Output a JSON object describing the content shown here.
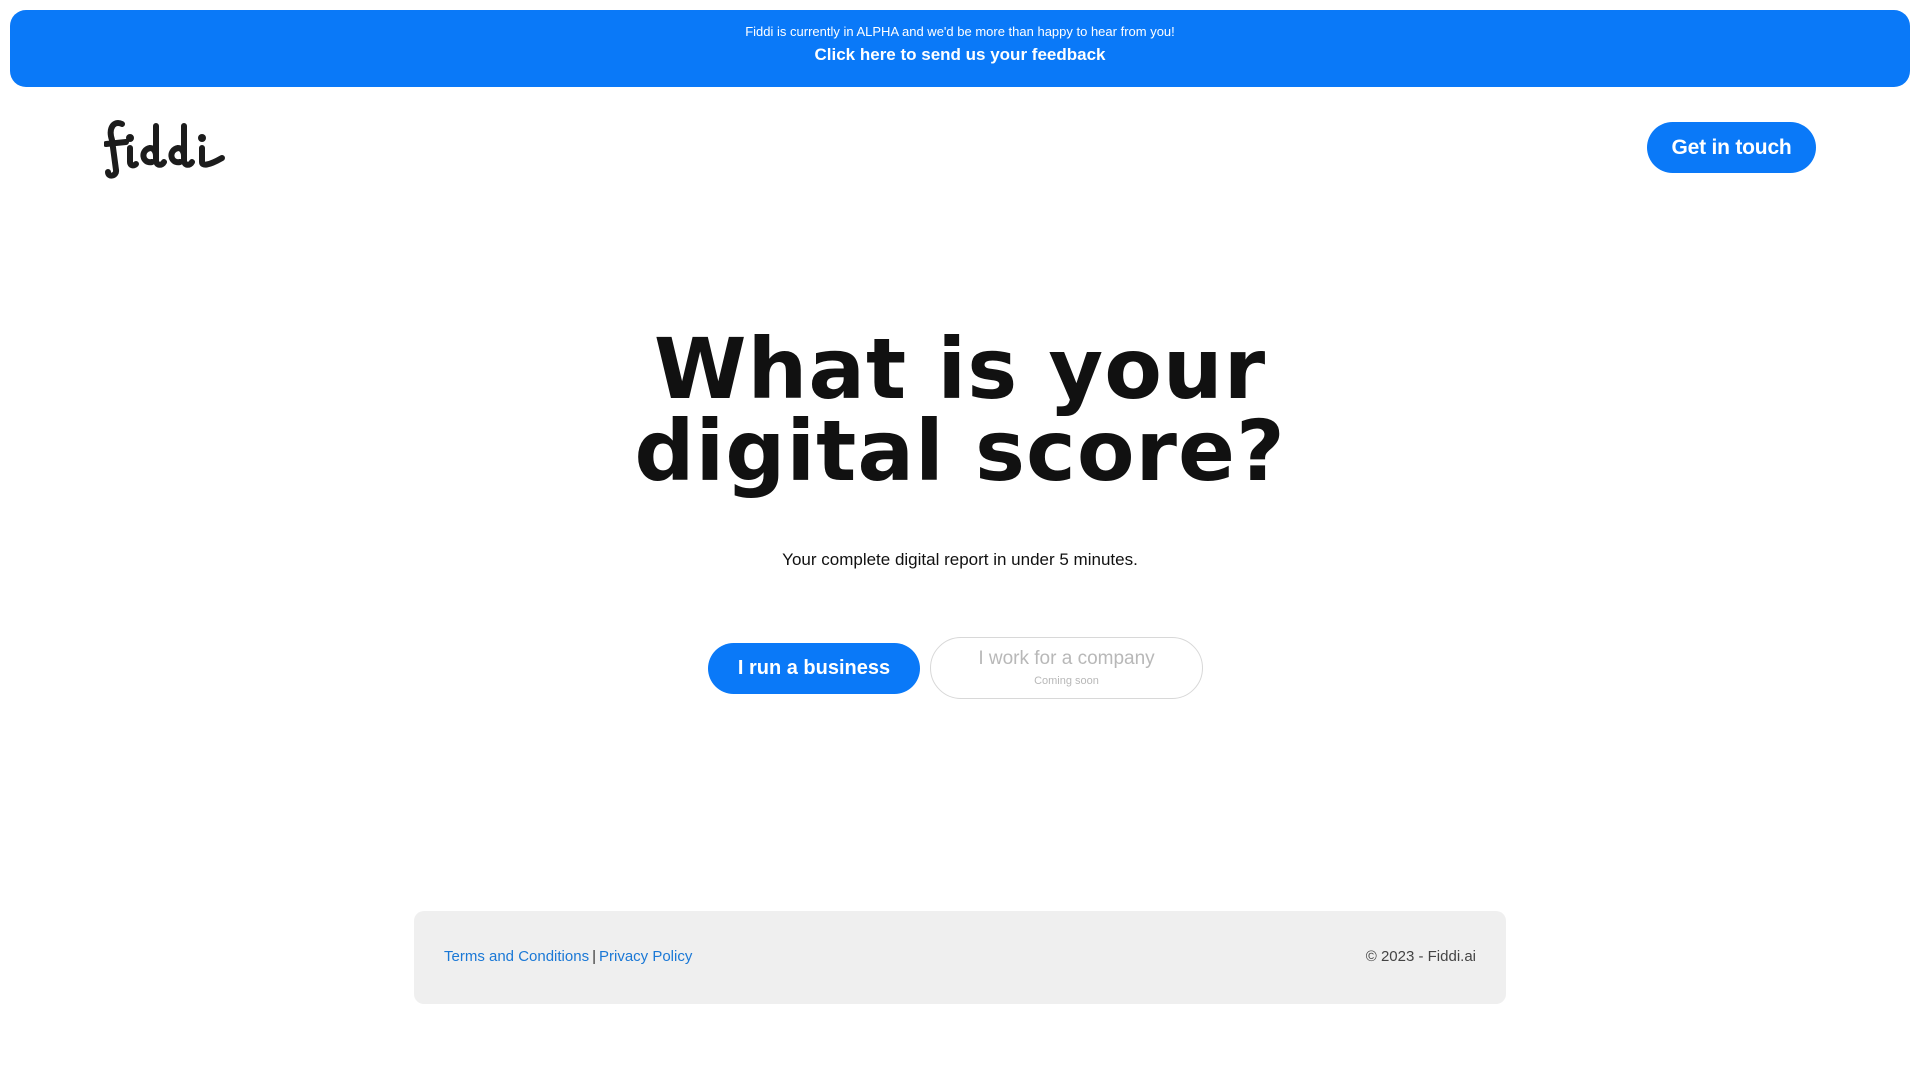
{
  "banner": {
    "message": "Fiddi is currently in ALPHA and we'd be more than happy to hear from you!",
    "link_label": "Click here to send us your feedback"
  },
  "header": {
    "logo_text": "fiddi",
    "cta_label": "Get in touch"
  },
  "hero": {
    "title_line1": "What is your",
    "title_line2": "digital score?",
    "subtitle": "Your complete digital report in under 5 minutes.",
    "primary_button": "I run a business",
    "secondary_button": "I work for a company",
    "secondary_note": "Coming soon"
  },
  "footer": {
    "terms_label": "Terms and Conditions",
    "separator": "|",
    "privacy_label": "Privacy Policy",
    "copyright": "© 2023 - Fiddi.ai"
  },
  "colors": {
    "accent": "#0a79f8",
    "footer_bg": "#efefef",
    "link": "#1a78d6"
  }
}
